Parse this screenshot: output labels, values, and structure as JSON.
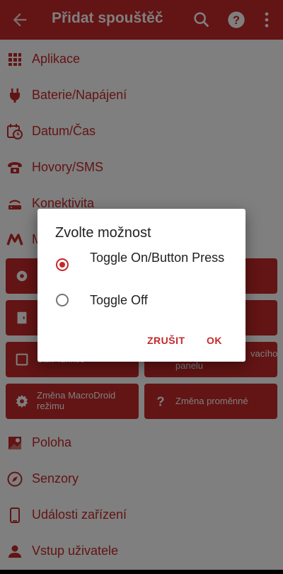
{
  "appbar": {
    "title": "Přidat spouštěč",
    "back_icon": "arrow-back-icon",
    "search_icon": "search-icon",
    "help_icon": "help-icon",
    "more_icon": "more-vert-icon"
  },
  "categories": [
    {
      "label": "Aplikace",
      "icon": "apps-grid-icon"
    },
    {
      "label": "Baterie/Napájení",
      "icon": "power-plug-icon"
    },
    {
      "label": "Datum/Čas",
      "icon": "calendar-clock-icon"
    },
    {
      "label": "Hovory/SMS",
      "icon": "phone-icon"
    },
    {
      "label": "Konektivita",
      "icon": "router-icon"
    },
    {
      "label": "M",
      "icon": "macrodroid-m-icon"
    },
    {
      "label": "Poloha",
      "icon": "map-pin-icon"
    },
    {
      "label": "Senzory",
      "icon": "compass-icon"
    },
    {
      "label": "Události zařízení",
      "icon": "smartphone-icon"
    },
    {
      "label": "Vstup uživatele",
      "icon": "person-icon"
    }
  ],
  "tiles": {
    "obscured_1": "Stav funkce",
    "obscured_2": "panelu",
    "macrodroid_mode": "Změna MacroDroid režimu",
    "variable_change": "Změna proměnné",
    "obscured_partial": "vacího"
  },
  "dialog": {
    "title": "Zvolte možnost",
    "options": [
      {
        "label": "Toggle On/Button Press",
        "selected": true
      },
      {
        "label": "Toggle Off",
        "selected": false
      }
    ],
    "cancel_label": "ZRUŠIT",
    "ok_label": "OK"
  },
  "colors": {
    "accent": "#c62828",
    "scrim": "#000000"
  }
}
